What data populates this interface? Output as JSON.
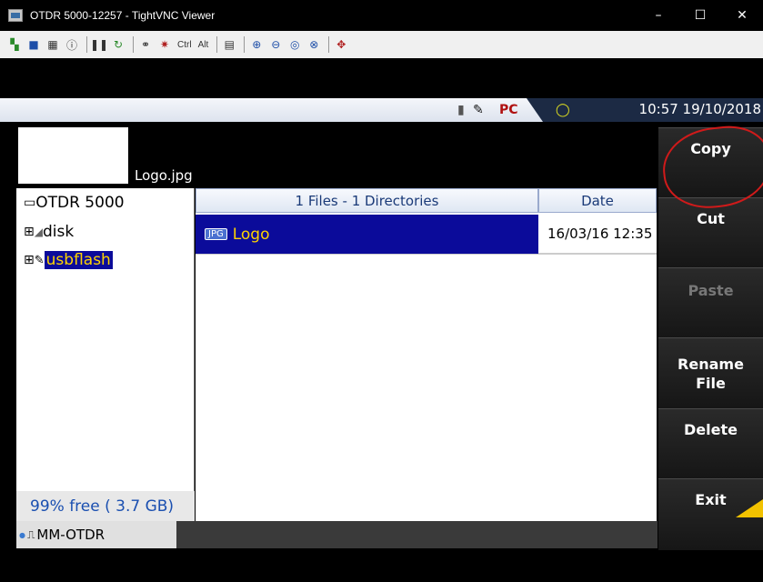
{
  "window": {
    "title": "OTDR 5000-12257 - TightVNC Viewer",
    "controls": [
      "–",
      "☐",
      "✕"
    ]
  },
  "toolbar": {
    "items": [
      {
        "name": "new-connection-icon",
        "glyph": "▚"
      },
      {
        "name": "save-icon",
        "glyph": "■"
      },
      {
        "name": "options-icon",
        "glyph": "▦"
      },
      {
        "name": "info-icon",
        "glyph": "ⓘ"
      },
      {
        "name": "pause-icon",
        "glyph": "❚❚"
      },
      {
        "name": "refresh-icon",
        "glyph": "↻"
      },
      {
        "name": "ctrl-alt-del-icon",
        "glyph": "⚭"
      },
      {
        "name": "win-key-icon",
        "glyph": "✷"
      },
      {
        "name": "ctrl-key",
        "text": "Ctrl"
      },
      {
        "name": "alt-key",
        "text": "Alt"
      },
      {
        "name": "clipboard-icon",
        "glyph": "▤"
      },
      {
        "name": "zoom-in-icon",
        "glyph": "⊕"
      },
      {
        "name": "zoom-out-icon",
        "glyph": "⊖"
      },
      {
        "name": "zoom-100-icon",
        "glyph": "◎"
      },
      {
        "name": "zoom-fit-icon",
        "glyph": "⊗"
      },
      {
        "name": "fullscreen-icon",
        "glyph": "✥"
      }
    ]
  },
  "status": {
    "time": "10:57 19/10/2018"
  },
  "preview": {
    "filename": "Logo.jpg"
  },
  "tree": {
    "root": "OTDR 5000",
    "items": [
      {
        "label": "disk",
        "expander": "⊞"
      },
      {
        "label": "usbflash",
        "expander": "⊞"
      }
    ],
    "free": "99% free ( 3.7 GB)",
    "tab": "MM-OTDR"
  },
  "list": {
    "header_name": "1 Files - 1 Directories",
    "header_date": "Date",
    "rows": [
      {
        "badge": "JPG",
        "name": "Logo",
        "date": "16/03/16 12:35"
      }
    ]
  },
  "softkeys": {
    "copy": "Copy",
    "cut": "Cut",
    "paste": "Paste",
    "rename_1": "Rename",
    "rename_2": "File",
    "delete": "Delete",
    "exit": "Exit"
  }
}
